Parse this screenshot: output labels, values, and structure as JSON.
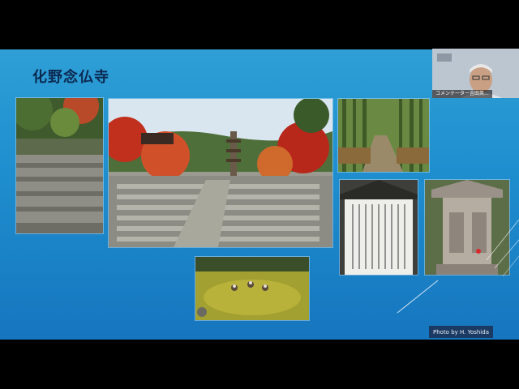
{
  "slide": {
    "title": "化野念仏寺",
    "credit": "Photo by H. Yoshida"
  },
  "participant": {
    "name": "コメンテーター吉田英..."
  },
  "photos": [
    {
      "name": "stone-stairs-photo"
    },
    {
      "name": "stone-statues-garden-photo"
    },
    {
      "name": "bamboo-path-photo"
    },
    {
      "name": "signboard-photo"
    },
    {
      "name": "stone-lantern-photo"
    },
    {
      "name": "moss-garden-photo"
    }
  ],
  "colors": {
    "slide_bg": "#1f8fcf",
    "title": "#0b2a52",
    "credit_bg": "#1b3a63"
  }
}
